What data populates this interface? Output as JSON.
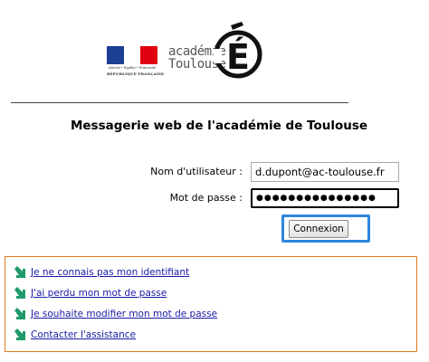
{
  "header": {
    "republic_motto": "Liberté • Égalité • Fraternité",
    "republic_name": "RÉPUBLIQUE FRANÇAISE",
    "academy_line1": "académie",
    "academy_line2": "Toulouse",
    "logo_letter": "É"
  },
  "page": {
    "title": "Messagerie web de l'académie de Toulouse"
  },
  "form": {
    "username_label": "Nom d'utilisateur :",
    "username_value": "d.dupont@ac-toulouse.fr",
    "password_label": "Mot de passe :",
    "password_value": "●●●●●●●●●●●●●●●",
    "submit_label": "Connexion"
  },
  "links": [
    {
      "label": "Je ne connais pas mon identifiant"
    },
    {
      "label": "J'ai perdu mon mot de passe"
    },
    {
      "label": "Je souhaite modifier mon mot de passe"
    },
    {
      "label": "Contacter l'assistance"
    }
  ],
  "colors": {
    "highlight": "#2e86de",
    "box_border": "#e07a1f",
    "link": "#1a1aa6",
    "arrow_icon": "#1e9a6a"
  }
}
